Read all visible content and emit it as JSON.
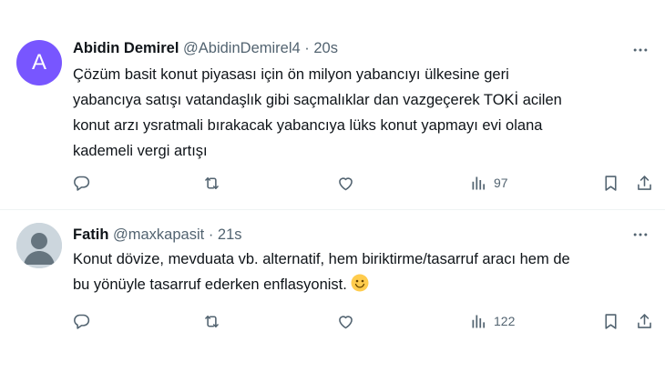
{
  "tweets": [
    {
      "avatar_letter": "A",
      "avatar_color": "#7856ff",
      "name": "Abidin Demirel",
      "handle": "@AbidinDemirel4",
      "separator": "·",
      "time": "20s",
      "lines": [
        "Çözüm basit konut piyasası için ön milyon yabancıyı ülkesine geri",
        "yabancıya satışı vatandaşlık gibi saçmalıklar dan vazgeçerek TOKİ acilen",
        "konut arzı ysratmali bırakacak yabancıya lüks konut yapmayı evi olana",
        "kademeli vergi artışı"
      ],
      "views": "97"
    },
    {
      "name": "Fatih",
      "handle": "@maxkapasit",
      "separator": "·",
      "time": "21s",
      "lines": [
        "Konut dövize, mevduata vb. alternatif, hem biriktirme/tasarruf aracı hem de",
        "bu yönüyle tasarruf ederken enflasyonist."
      ],
      "emoji": "slightly-smiling-face",
      "views": "122"
    }
  ],
  "icons": [
    "more-icon",
    "reply-icon",
    "retweet-icon",
    "like-icon",
    "views-icon",
    "bookmark-icon",
    "share-icon"
  ],
  "colors": {
    "text": "#0f1419",
    "secondary": "#536471",
    "divider": "#eff3f4",
    "avatar_a": "#7856ff"
  }
}
